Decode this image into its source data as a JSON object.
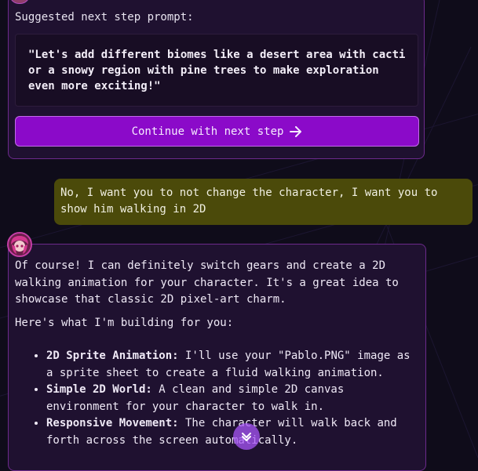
{
  "suggestion": {
    "label": "Suggested next step prompt:",
    "prompt_lines": [
      "\"Let's add different biomes like a desert area with cacti",
      "or a snowy region with pine trees to make exploration",
      "even more exciting!\""
    ],
    "continue_label": "Continue with next step"
  },
  "user_message": {
    "lines": [
      "No, I want you to not change the character, I want you to",
      "show him walking in 2D"
    ]
  },
  "assistant_message": {
    "intro_lines": [
      "Of course! I can definitely switch gears and create a 2D",
      "walking animation for your character. It's a great idea to",
      "showcase that classic 2D pixel-art charm."
    ],
    "plan_intro": "Here's what I'm building for you:",
    "features": [
      {
        "title": "2D Sprite Animation:",
        "text": " I'll use your \"Pablo.PNG\" image as a sprite sheet to create a fluid walking animation."
      },
      {
        "title": "Simple 2D World:",
        "text": " A clean and simple 2D canvas environment for your character to walk in."
      },
      {
        "title": "Responsive Movement:",
        "text": " The character will walk back and forth across the screen automatically."
      }
    ]
  },
  "icons": {
    "continue_arrow": "arrow-right-icon",
    "scroll_down": "chevron-down-icon",
    "avatar": "assistant-avatar"
  },
  "colors": {
    "background": "#0f0c1a",
    "card_background": "#1f1130",
    "card_border": "#6c2a8c",
    "continue_button": "#8b0ac9",
    "user_bubble": "#4b4a0a",
    "scroll_button": "#a855f7"
  }
}
